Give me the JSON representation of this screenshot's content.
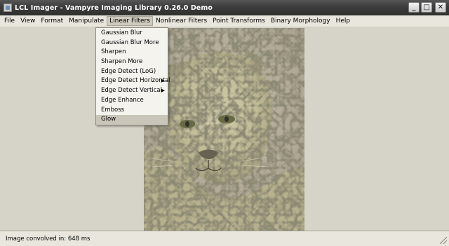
{
  "window": {
    "title": "LCL Imager - Vampyre Imaging Library 0.26.0 Demo",
    "buttons": {
      "minimize": "_",
      "maximize": "□",
      "close": "✕"
    }
  },
  "menubar": {
    "items": [
      {
        "label": "File"
      },
      {
        "label": "View"
      },
      {
        "label": "Format"
      },
      {
        "label": "Manipulate"
      },
      {
        "label": "Linear Filters"
      },
      {
        "label": "Nonlinear Filters"
      },
      {
        "label": "Point Transforms"
      },
      {
        "label": "Binary Morphology"
      },
      {
        "label": "Help"
      }
    ],
    "active": "Linear Filters"
  },
  "dropdown": {
    "items": [
      {
        "label": "Gaussian Blur",
        "submenu": false
      },
      {
        "label": "Gaussian Blur More",
        "submenu": false
      },
      {
        "label": "Sharpen",
        "submenu": false
      },
      {
        "label": "Sharpen More",
        "submenu": false
      },
      {
        "label": "Edge Detect (LoG)",
        "submenu": false
      },
      {
        "label": "Edge Detect Horizontal",
        "submenu": true
      },
      {
        "label": "Edge Detect Vertical",
        "submenu": true
      },
      {
        "label": "Edge Enhance",
        "submenu": false
      },
      {
        "label": "Emboss",
        "submenu": false
      },
      {
        "label": "Glow",
        "submenu": false
      }
    ],
    "highlighted": "Glow",
    "submenu_arrow": "▶"
  },
  "image": {
    "subject": "snow leopard photo"
  },
  "statusbar": {
    "text": "Image convolved in: 648 ms"
  },
  "colors": {
    "titlebar": "#3c3c3c",
    "menu_bg": "#e9e7dd",
    "client_bg": "#d6d3c8",
    "highlight": "#c9c5b9"
  }
}
